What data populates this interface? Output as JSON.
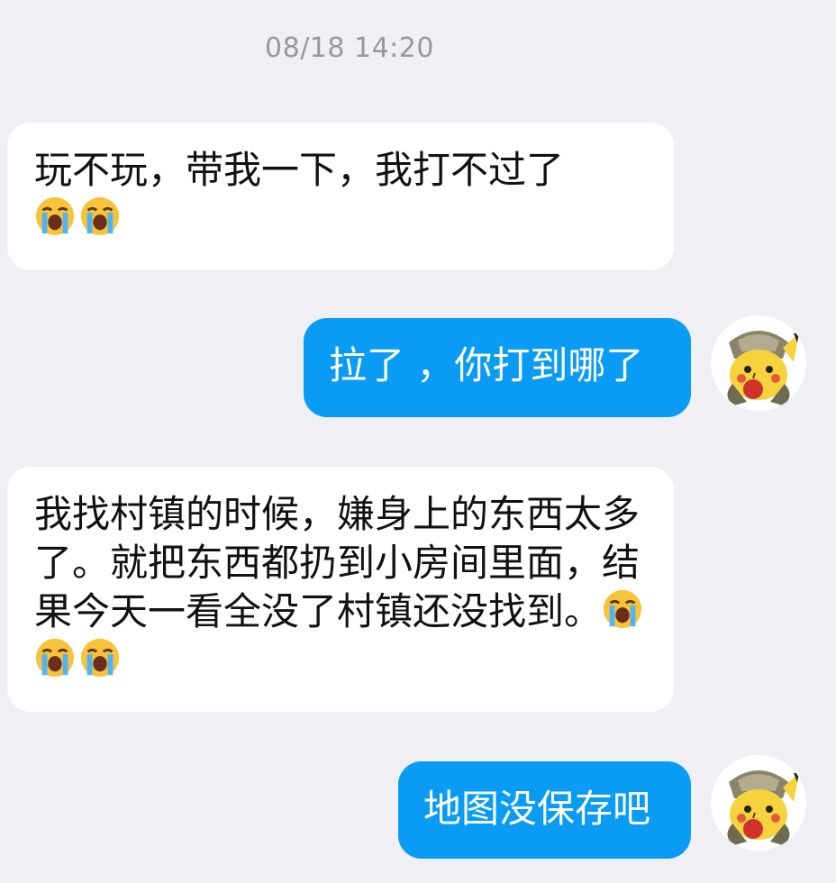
{
  "timestamp": "08/18 14:20",
  "messages": [
    {
      "side": "received",
      "text": "玩不玩，带我一下，我打不过了",
      "emoji_count": 2,
      "emoji_icon": "loudly-crying-face-icon"
    },
    {
      "side": "sent",
      "text": "拉了 ，你打到哪了",
      "avatar_icon": "pikachu-avatar-icon"
    },
    {
      "side": "received",
      "text": "我找村镇的时候，嫌身上的东西太多了。就把东西都扔到小房间里面，结果今天一看全没了村镇还没找到。",
      "emoji_count": 3,
      "emoji_icon": "loudly-crying-face-icon"
    },
    {
      "side": "sent",
      "text": "地图没保存吧",
      "avatar_icon": "pikachu-avatar-icon"
    }
  ],
  "colors": {
    "background": "#efeff4",
    "received_bubble": "#ffffff",
    "sent_bubble": "#0a9bf5",
    "timestamp_text": "#999999"
  }
}
